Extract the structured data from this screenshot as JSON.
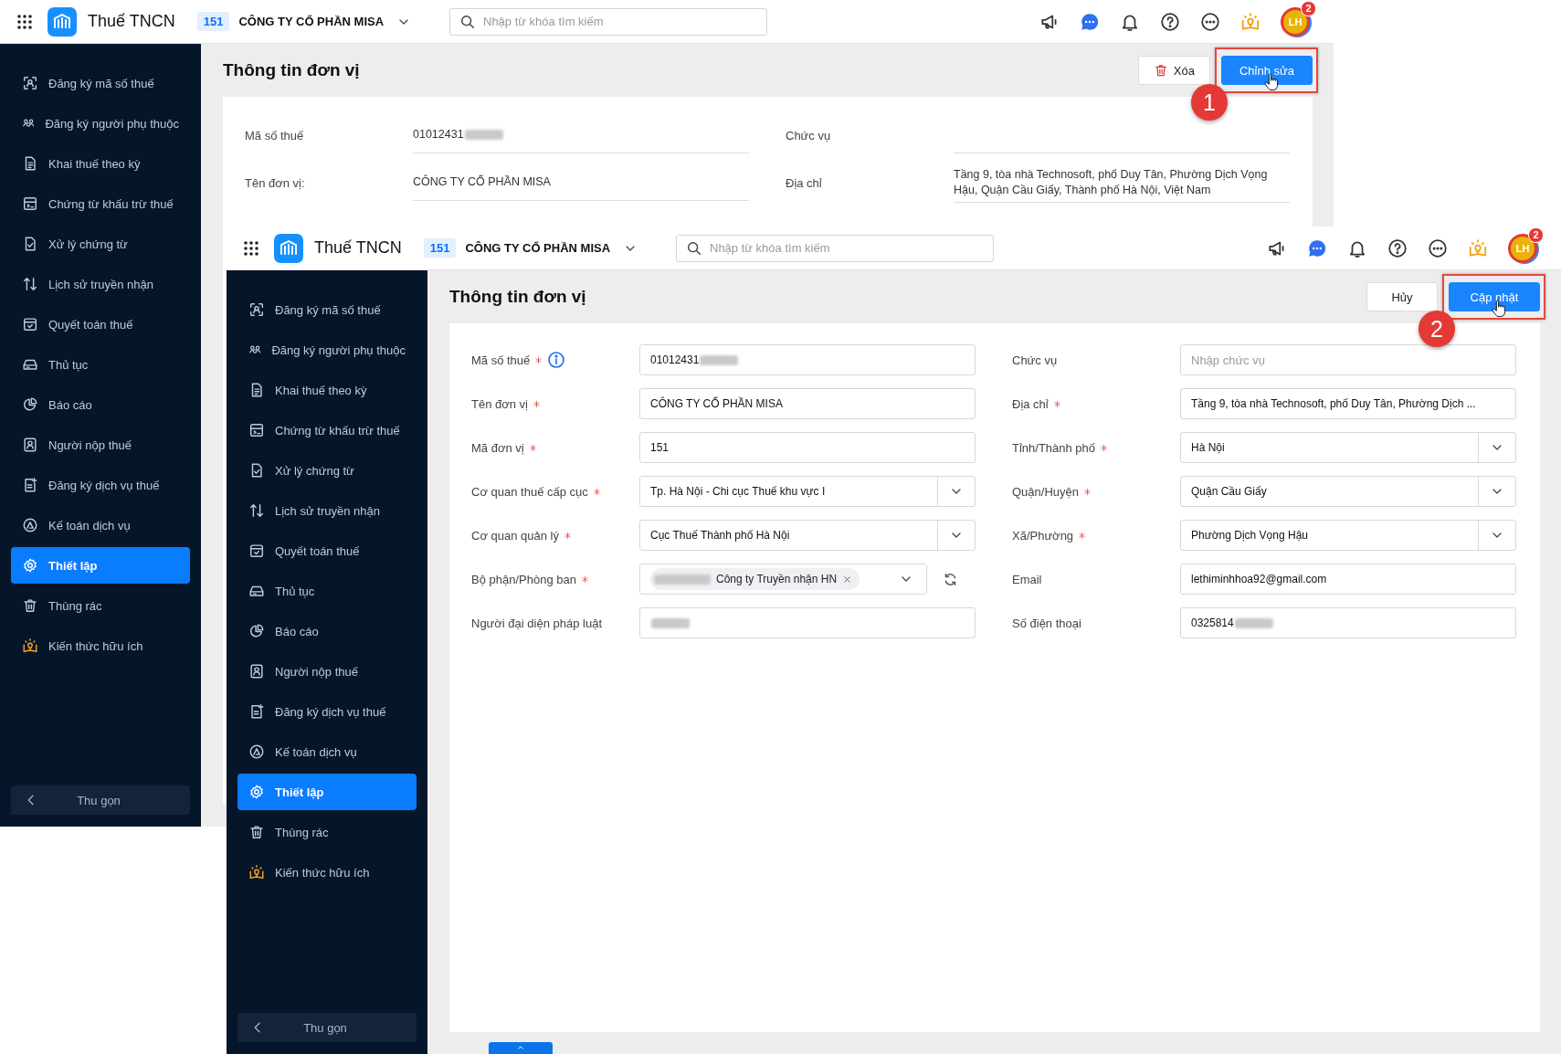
{
  "windows": [
    {
      "header": {
        "app_name": "Thuế TNCN",
        "unit_code": "151",
        "company": "CÔNG TY CỔ PHẦN MISA",
        "search_placeholder": "Nhập từ khóa tìm kiếm",
        "notification_count": "2",
        "avatar_initials": "LH"
      },
      "sidebar": {
        "items": [
          {
            "label": "Đăng ký mã số thuế",
            "selected": false
          },
          {
            "label": "Đăng ký người phụ thuộc",
            "selected": false
          },
          {
            "label": "Khai thuế theo kỳ",
            "selected": false
          },
          {
            "label": "Chứng từ khấu trừ thuế",
            "selected": false
          },
          {
            "label": "Xử lý chứng từ",
            "selected": false
          },
          {
            "label": "Lịch sử truyền nhận",
            "selected": false
          },
          {
            "label": "Quyết toán thuế",
            "selected": false
          },
          {
            "label": "Thủ tục",
            "selected": false
          },
          {
            "label": "Báo cáo",
            "selected": false
          },
          {
            "label": "Người nộp thuế",
            "selected": false
          },
          {
            "label": "Đăng ký dịch vụ thuế",
            "selected": false
          },
          {
            "label": "Kế toán dịch vụ",
            "selected": false
          },
          {
            "label": "Thiết lập",
            "selected": true
          },
          {
            "label": "Thùng rác",
            "selected": false
          },
          {
            "label": "Kiến thức hữu ích",
            "selected": false
          }
        ],
        "collapse_label": "Thu gọn"
      },
      "page": {
        "title": "Thông tin đơn vị",
        "step_number": "1",
        "buttons": [
          {
            "label": "Xóa",
            "kind": "delete",
            "highlighted": false
          },
          {
            "label": "Chỉnh sửa",
            "kind": "primary",
            "highlighted": true
          }
        ]
      },
      "form": {
        "left": [
          {
            "kind": "display",
            "label": "Mã số thuế",
            "value": "01012431",
            "redacted": true
          },
          {
            "kind": "display",
            "label": "Tên đơn vị:",
            "value": "CÔNG TY CỔ PHẦN MISA"
          }
        ],
        "right": [
          {
            "kind": "display",
            "label": "Chức vụ"
          },
          {
            "kind": "display",
            "label": "Địa chỉ",
            "value": "Tầng 9, tòa nhà Technosoft, phố Duy Tân, Phường Dịch Vọng Hậu, Quận Cầu Giấy, Thành phố Hà Nội, Việt Nam"
          }
        ]
      }
    },
    {
      "header": {
        "app_name": "Thuế TNCN",
        "unit_code": "151",
        "company": "CÔNG TY CỔ PHẦN MISA",
        "search_placeholder": "Nhập từ khóa tìm kiếm",
        "notification_count": "2",
        "avatar_initials": "LH"
      },
      "sidebar": {
        "items": [
          {
            "label": "Đăng ký mã số thuế",
            "selected": false
          },
          {
            "label": "Đăng ký người phụ thuộc",
            "selected": false
          },
          {
            "label": "Khai thuế theo kỳ",
            "selected": false
          },
          {
            "label": "Chứng từ khấu trừ thuế",
            "selected": false
          },
          {
            "label": "Xử lý chứng từ",
            "selected": false
          },
          {
            "label": "Lịch sử truyền nhận",
            "selected": false
          },
          {
            "label": "Quyết toán thuế",
            "selected": false
          },
          {
            "label": "Thủ tục",
            "selected": false
          },
          {
            "label": "Báo cáo",
            "selected": false
          },
          {
            "label": "Người nộp thuế",
            "selected": false
          },
          {
            "label": "Đăng ký dịch vụ thuế",
            "selected": false
          },
          {
            "label": "Kế toán dịch vụ",
            "selected": false
          },
          {
            "label": "Thiết lập",
            "selected": true
          },
          {
            "label": "Thùng rác",
            "selected": false
          },
          {
            "label": "Kiến thức hữu ích",
            "selected": false
          }
        ],
        "collapse_label": "Thu gọn"
      },
      "page": {
        "title": "Thông tin đơn vị",
        "step_number": "2",
        "buttons": [
          {
            "label": "Hủy",
            "kind": "secondary",
            "highlighted": false
          },
          {
            "label": "Cập nhật",
            "kind": "primary",
            "highlighted": true
          }
        ]
      },
      "form": {
        "left": [
          {
            "kind": "text",
            "label": "Mã số thuế",
            "required": true,
            "info": true,
            "value": "01012431",
            "redacted": true
          },
          {
            "kind": "text",
            "label": "Tên đơn vị",
            "required": true,
            "value": "CÔNG TY CỔ PHẦN MISA"
          },
          {
            "kind": "text",
            "label": "Mã đơn vị",
            "required": true,
            "value": "151"
          },
          {
            "kind": "select",
            "label": "Cơ quan thuế cấp cục",
            "required": true,
            "value": "Tp. Hà Nội - Chi cục Thuế khu vực I"
          },
          {
            "kind": "select",
            "label": "Cơ quan quản lý",
            "required": true,
            "value": "Cục Thuế Thành phố Hà Nội"
          },
          {
            "kind": "tags",
            "label": "Bộ phận/Phòng ban",
            "required": true,
            "tags": [
              {
                "label": "Công ty Truyền nhận HN",
                "redacted": true
              }
            ]
          },
          {
            "kind": "text",
            "label": "Người đại diện pháp luật",
            "required": false,
            "redacted": true
          }
        ],
        "right": [
          {
            "kind": "text",
            "label": "Chức vụ",
            "required": false,
            "placeholder": "Nhập chức vụ"
          },
          {
            "kind": "text",
            "label": "Địa chỉ",
            "required": true,
            "value": "Tầng 9, tòa nhà Technosoft, phố Duy Tân, Phường Dịch ..."
          },
          {
            "kind": "select",
            "label": "Tỉnh/Thành phố",
            "required": true,
            "value": "Hà Nội"
          },
          {
            "kind": "select",
            "label": "Quận/Huyện",
            "required": true,
            "value": "Quận Cầu Giấy"
          },
          {
            "kind": "select",
            "label": "Xã/Phường",
            "required": true,
            "value": "Phường Dịch Vọng Hậu"
          },
          {
            "kind": "text",
            "label": "Email",
            "required": false,
            "value": "lethiminhhoa92@gmail.com"
          },
          {
            "kind": "text",
            "label": "Số điện thoại",
            "required": false,
            "value": "0325814",
            "redacted": true
          }
        ]
      }
    }
  ]
}
